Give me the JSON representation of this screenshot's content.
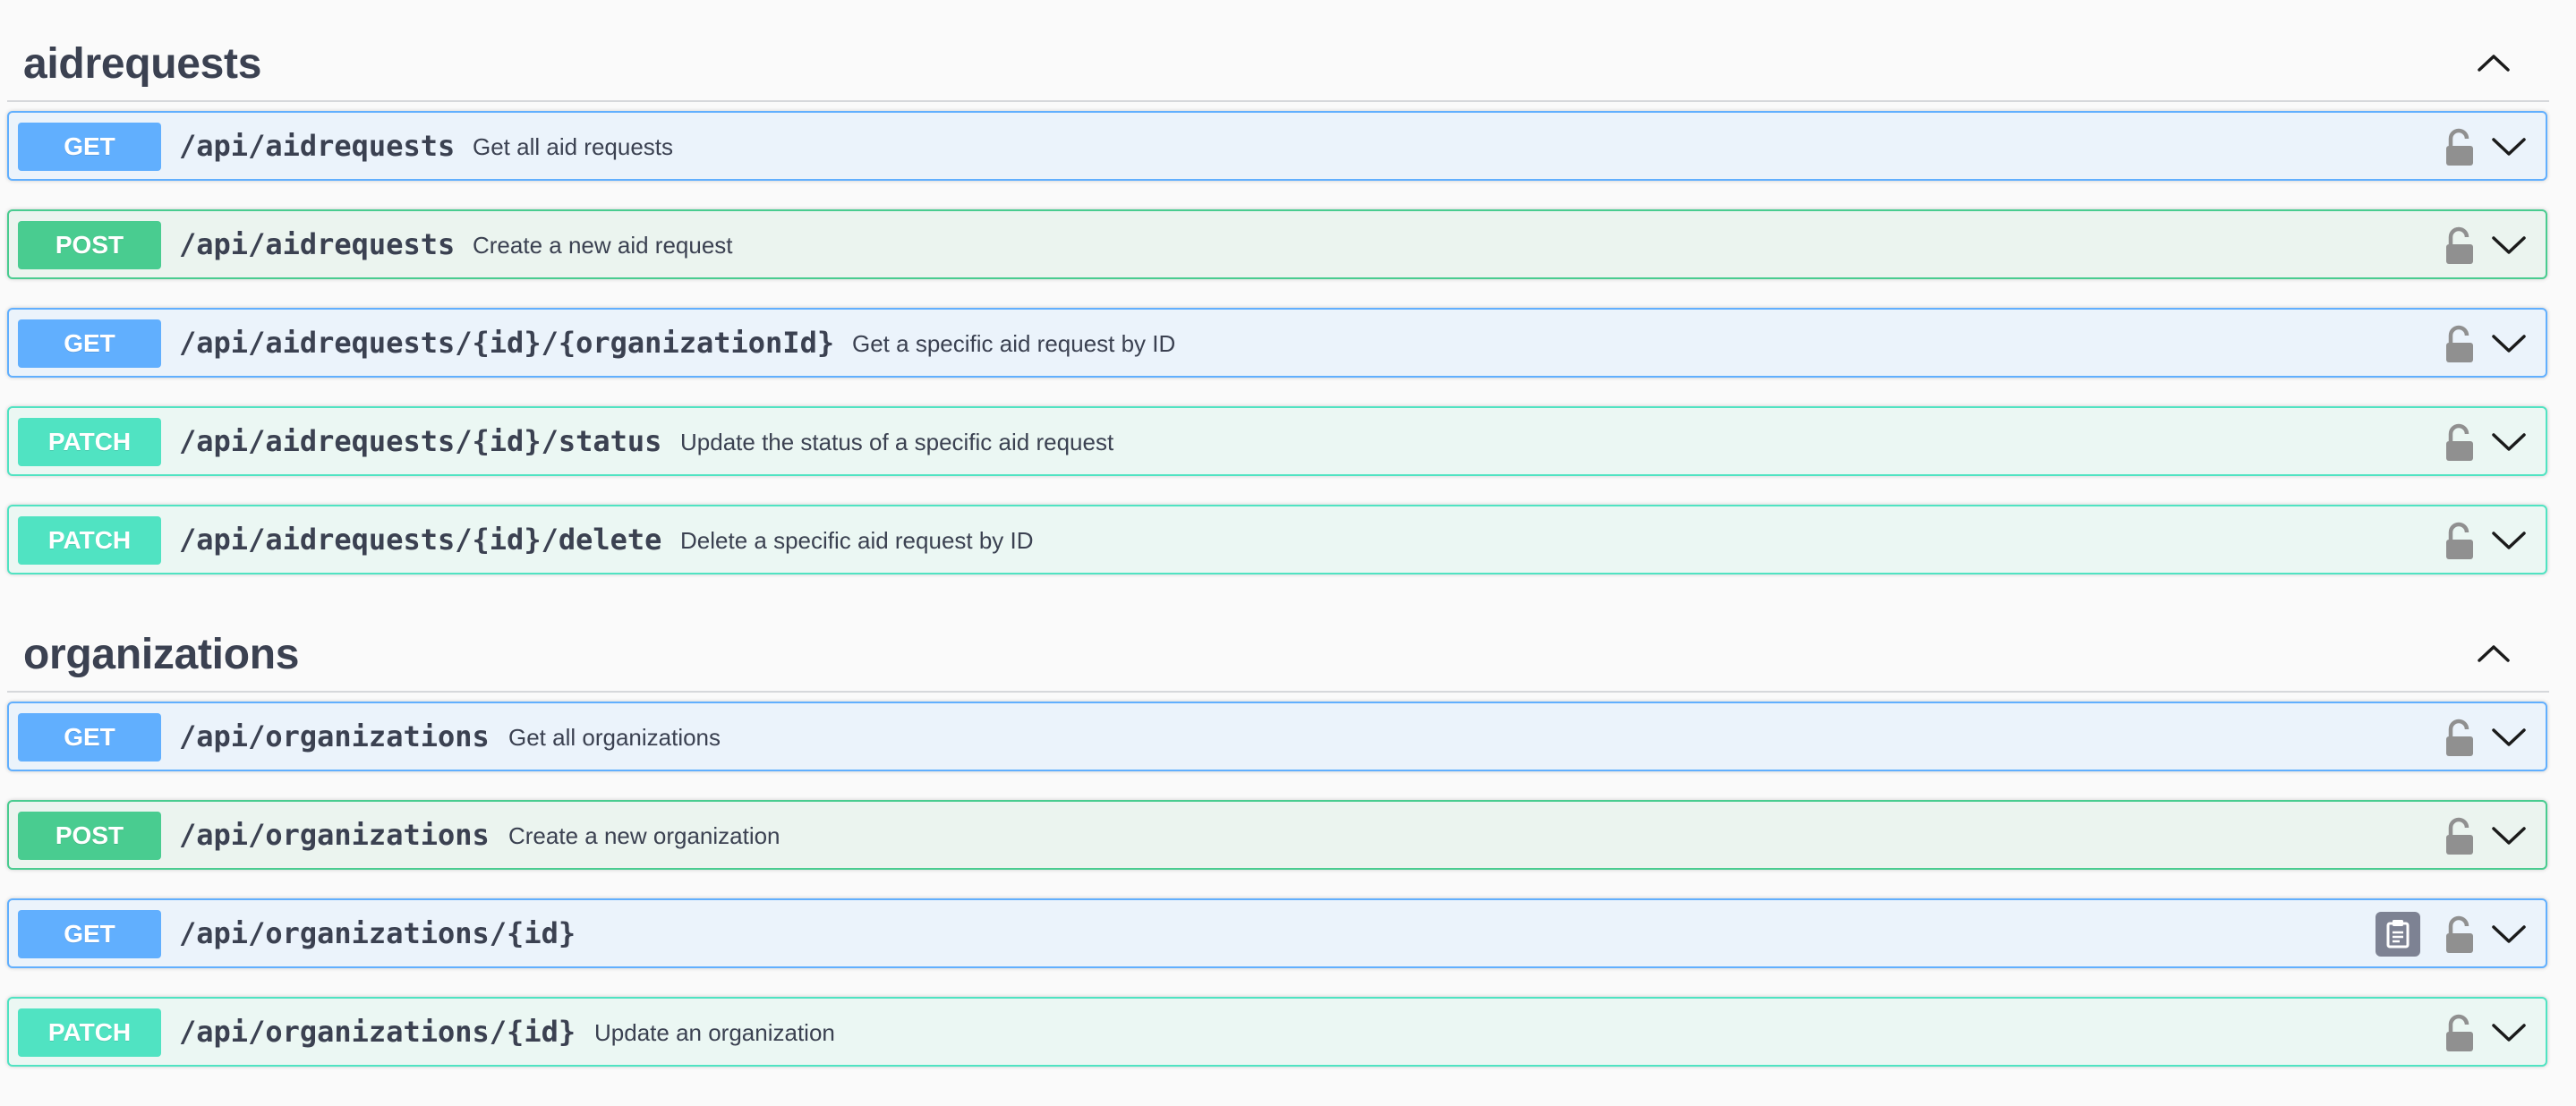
{
  "sections": [
    {
      "title": "aidrequests",
      "operations": [
        {
          "method": "GET",
          "path": "/api/aidrequests",
          "summary": "Get all aid requests"
        },
        {
          "method": "POST",
          "path": "/api/aidrequests",
          "summary": "Create a new aid request"
        },
        {
          "method": "GET",
          "path": "/api/aidrequests/{id}/{organizationId}",
          "summary": "Get a specific aid request by ID"
        },
        {
          "method": "PATCH",
          "path": "/api/aidrequests/{id}/status",
          "summary": "Update the status of a specific aid request"
        },
        {
          "method": "PATCH",
          "path": "/api/aidrequests/{id}/delete",
          "summary": "Delete a specific aid request by ID"
        }
      ]
    },
    {
      "title": "organizations",
      "operations": [
        {
          "method": "GET",
          "path": "/api/organizations",
          "summary": "Get all organizations"
        },
        {
          "method": "POST",
          "path": "/api/organizations",
          "summary": "Create a new organization"
        },
        {
          "method": "GET",
          "path": "/api/organizations/{id}",
          "summary": ""
        },
        {
          "method": "PATCH",
          "path": "/api/organizations/{id}",
          "summary": "Update an organization"
        }
      ]
    }
  ],
  "icons": {
    "section_toggle": "chevron-up-icon",
    "lock": "unlocked-padlock-icon",
    "expand": "chevron-down-icon",
    "copy": "clipboard-copy-icon"
  },
  "colors": {
    "get": "#61affe",
    "post": "#49cc90",
    "patch": "#50e3c2",
    "text": "#3b4151",
    "lock": "#909090"
  }
}
